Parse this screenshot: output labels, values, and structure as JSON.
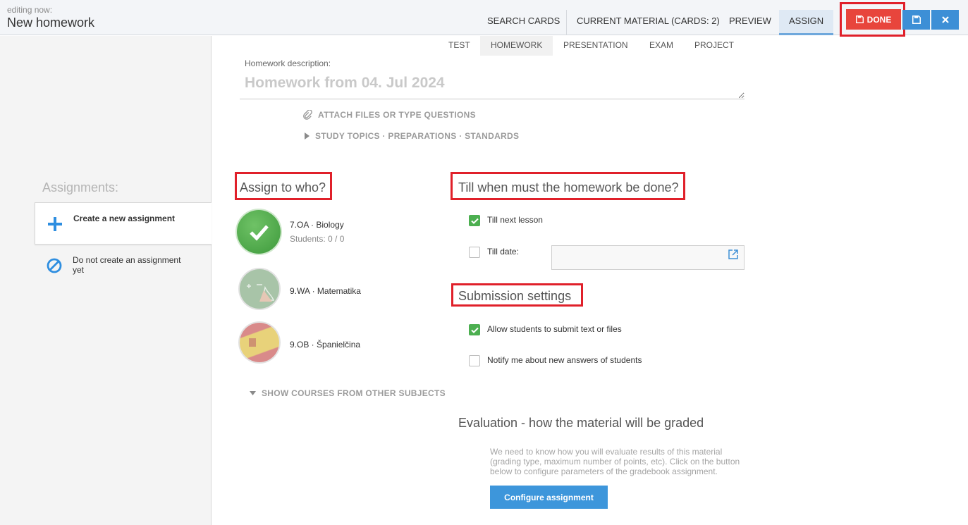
{
  "header": {
    "editing_label": "editing now:",
    "editing_title": "New homework",
    "tabs": [
      {
        "label": "SEARCH CARDS"
      },
      {
        "label": "CURRENT MATERIAL (CARDS: 2)"
      },
      {
        "label": "PREVIEW"
      },
      {
        "label": "ASSIGN"
      }
    ],
    "done_label": "DONE",
    "save_icon": "floppy-disk-icon",
    "close_icon": "close-icon"
  },
  "material_types": [
    {
      "label": "TEST"
    },
    {
      "label": "HOMEWORK"
    },
    {
      "label": "PRESENTATION"
    },
    {
      "label": "EXAM"
    },
    {
      "label": "PROJECT"
    }
  ],
  "description": {
    "label": "Homework description:",
    "value": "Homework from 04. Jul 2024"
  },
  "links": {
    "attach": "ATTACH FILES OR TYPE QUESTIONS",
    "topics": "STUDY TOPICS · PREPARATIONS · STANDARDS"
  },
  "sidebar": {
    "heading": "Assignments:",
    "items": [
      {
        "label": "Create a new assignment",
        "icon": "plus-icon"
      },
      {
        "label": "Do not create an assignment yet",
        "icon": "no-entry-icon"
      }
    ]
  },
  "assign": {
    "heading": "Assign to who?",
    "courses": [
      {
        "name": "7.OA · Biology",
        "students": "Students: 0 / 0",
        "selected": true
      },
      {
        "name": "9.WA · Matematika"
      },
      {
        "name": "9.OB · Španielčina"
      }
    ],
    "show_more": "SHOW COURSES FROM OTHER SUBJECTS"
  },
  "deadline": {
    "heading": "Till when must the homework be done?",
    "next_lesson": "Till next lesson",
    "till_date": "Till date:"
  },
  "submission": {
    "heading": "Submission settings",
    "allow_submit": "Allow students to submit text or files",
    "notify": "Notify me about new answers of students"
  },
  "evaluation": {
    "heading": "Evaluation - how the material will be graded",
    "text": "We need to know how you will evaluate results of this material (grading type, maximum number of points, etc). Click on the button below to configure parameters of the gradebook assignment.",
    "button": "Configure assignment"
  },
  "colors": {
    "done_red": "#e8453c",
    "highlight_red": "#e0202a",
    "primary_blue": "#3d8fd6",
    "check_green": "#4caf50"
  }
}
